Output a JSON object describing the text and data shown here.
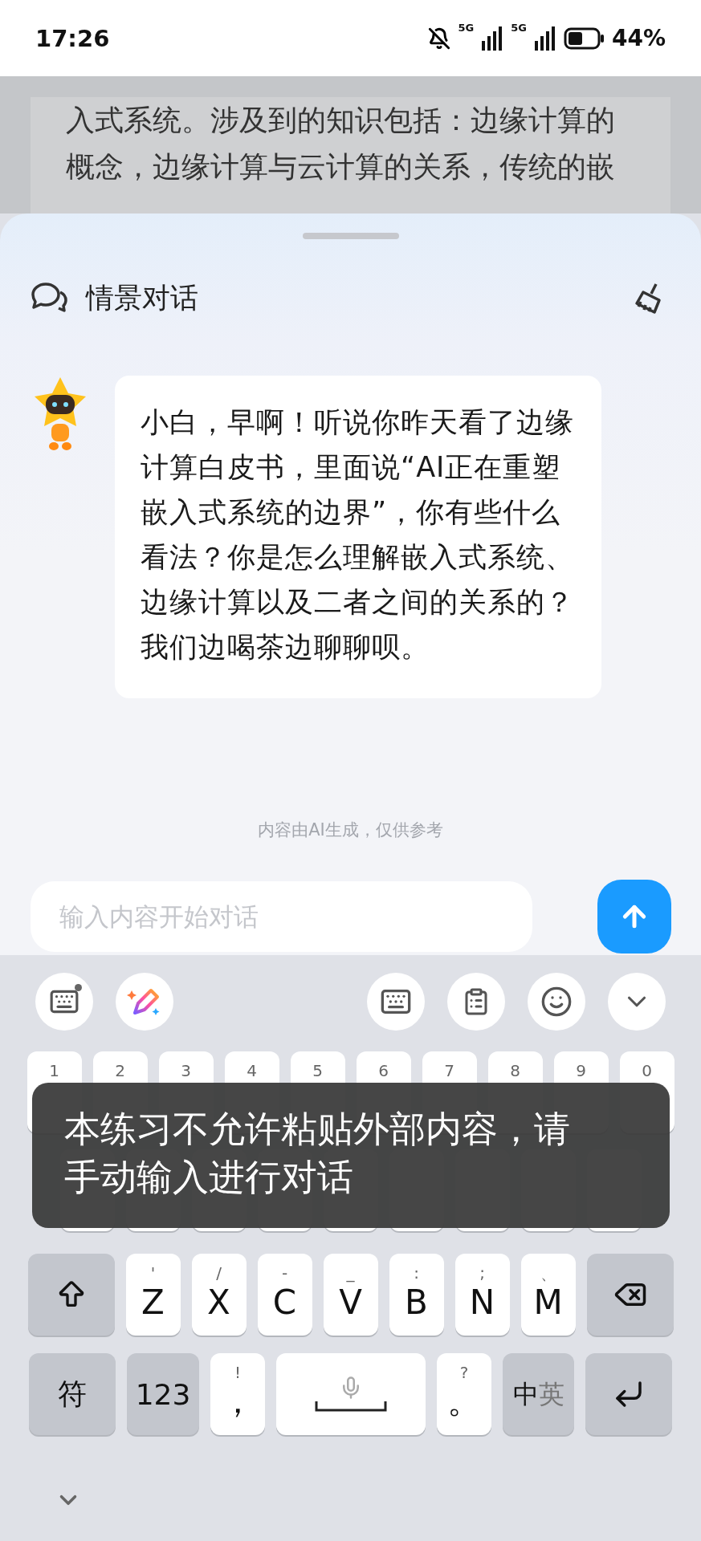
{
  "status_bar": {
    "time": "17:26",
    "network_1": "5G",
    "network_2": "5G",
    "battery": "44%",
    "muted": true
  },
  "background_text": [
    "入式系统。涉及到的知识包括：边缘计算的",
    "概念，边缘计算与云计算的关系，传统的嵌"
  ],
  "sheet": {
    "title": "情景对话"
  },
  "messages": [
    {
      "text": "小白，早啊！听说你昨天看了边缘计算白皮书，里面说“AI正在重塑嵌入式系统的边界”，你有些什么看法？你是怎么理解嵌入式系统、边缘计算以及二者之间的关系的？我们边喝茶边聊聊呗。"
    }
  ],
  "disclaimer": "内容由AI生成，仅供参考",
  "input": {
    "placeholder": "输入内容开始对话"
  },
  "keyboard": {
    "toolbar_left": [
      {
        "kind": "keyboard-settings"
      },
      {
        "kind": "pen"
      }
    ],
    "toolbar_right": [
      {
        "kind": "keyboard"
      },
      {
        "kind": "clipboard"
      },
      {
        "kind": "emoji"
      },
      {
        "kind": "collapse"
      }
    ],
    "number_row": [
      {
        "kind": "letter",
        "hint": "1"
      },
      {
        "kind": "letter",
        "hint": "2"
      },
      {
        "kind": "letter",
        "hint": "3"
      },
      {
        "kind": "letter",
        "hint": "4"
      },
      {
        "kind": "letter",
        "hint": "5"
      },
      {
        "kind": "letter",
        "hint": "6"
      },
      {
        "kind": "letter",
        "hint": "7"
      },
      {
        "kind": "letter",
        "hint": "8"
      },
      {
        "kind": "letter",
        "hint": "9"
      },
      {
        "kind": "letter",
        "hint": "0"
      }
    ],
    "middle_row": [
      {
        "kind": "letter"
      },
      {
        "kind": "letter"
      },
      {
        "kind": "letter"
      },
      {
        "kind": "letter"
      },
      {
        "kind": "letter"
      },
      {
        "kind": "letter"
      },
      {
        "kind": "letter"
      },
      {
        "kind": "letter"
      },
      {
        "kind": "letter"
      }
    ],
    "letter_row": [
      {
        "kind": "shift"
      },
      {
        "kind": "letter",
        "hint": "'",
        "label": "Z"
      },
      {
        "kind": "letter",
        "hint": "/",
        "label": "X"
      },
      {
        "kind": "letter",
        "hint": "-",
        "label": "C"
      },
      {
        "kind": "letter",
        "hint": "_",
        "label": "V"
      },
      {
        "kind": "letter",
        "hint": ":",
        "label": "B"
      },
      {
        "kind": "letter",
        "hint": ";",
        "label": "N"
      },
      {
        "kind": "letter",
        "hint": "、",
        "label": "M"
      },
      {
        "kind": "backspace"
      }
    ],
    "bottom_row": [
      {
        "kind": "function",
        "label": "符"
      },
      {
        "kind": "function",
        "label": "123"
      },
      {
        "kind": "letter",
        "hint": "!",
        "label": "，"
      },
      {
        "kind": "space"
      },
      {
        "kind": "letter",
        "hint": "?",
        "label": "。"
      },
      {
        "kind": "language",
        "label": "中",
        "sublabel": "英"
      },
      {
        "kind": "enter"
      }
    ]
  },
  "toast": "本练习不允许粘贴外部内容，请手动输入进行对话"
}
